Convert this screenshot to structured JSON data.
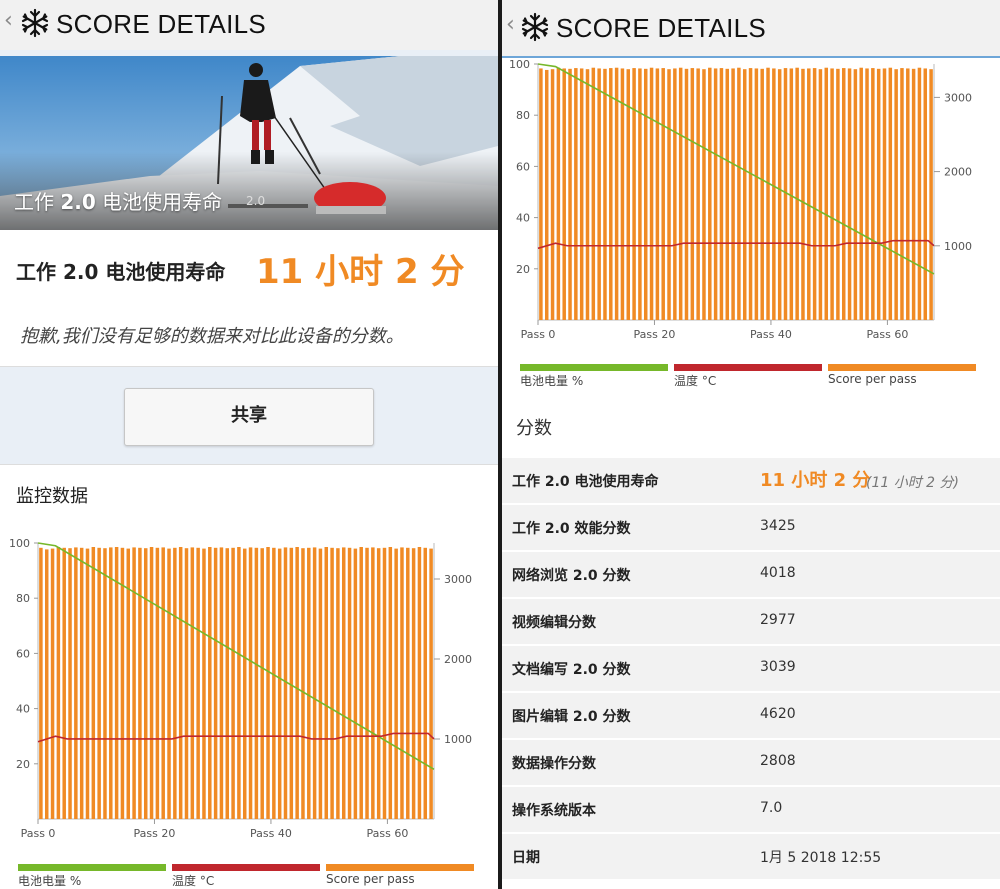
{
  "app": {
    "title": "SCORE DETAILS"
  },
  "left": {
    "hero_caption_prefix": "工作 ",
    "hero_caption_bold": "2.0",
    "hero_caption_suffix": " 电池使用寿命",
    "hero_version": "2.0",
    "result_name": "工作 2.0 电池使用寿命",
    "result_score": "11 小时 2 分",
    "sorry_text": "抱歉,我们没有足够的数据来对比此设备的分数。",
    "share_label": "共享",
    "monitor_title": "监控数据"
  },
  "legend": {
    "battery": "电池电量 %",
    "temp": "温度 °C",
    "score": "Score per pass"
  },
  "colors": {
    "battery": "#76b82a",
    "temp": "#c0272d",
    "score": "#f08a24",
    "accent": "#f08a24"
  },
  "scores": {
    "title": "分数",
    "rows": [
      {
        "label": "工作 2.0 电池使用寿命",
        "value": "11 小时 2 分",
        "sub": "(11 小时 2 分)"
      },
      {
        "label": "工作 2.0 效能分数",
        "value": "3425"
      },
      {
        "label": "网络浏览 2.0 分数",
        "value": "4018"
      },
      {
        "label": "视频编辑分数",
        "value": "2977"
      },
      {
        "label": "文档编写 2.0 分数",
        "value": "3039"
      },
      {
        "label": "图片编辑 2.0 分数",
        "value": "4620"
      },
      {
        "label": "数据操作分数",
        "value": "2808"
      },
      {
        "label": "操作系统版本",
        "value": "7.0"
      },
      {
        "label": "日期",
        "value": "1月 5 2018 12:55"
      }
    ]
  },
  "chart_data": {
    "type": "bar",
    "x_tick_labels": [
      "Pass 0",
      "Pass 20",
      "Pass 40",
      "Pass 60"
    ],
    "x_ticks": [
      0,
      20,
      40,
      60
    ],
    "x_range": [
      0,
      68
    ],
    "y_left_ticks": [
      20,
      40,
      60,
      80,
      100
    ],
    "y_left_range": [
      0,
      100
    ],
    "y_right_ticks": [
      1000,
      2000,
      3000
    ],
    "y_right_range": [
      0,
      3450
    ],
    "grid": false,
    "legend_position": "bottom",
    "series": [
      {
        "name": "Score per pass",
        "type": "bar",
        "axis": "right",
        "values": [
          3390,
          3370,
          3380,
          3400,
          3390,
          3385,
          3395,
          3390,
          3380,
          3400,
          3390,
          3385,
          3395,
          3400,
          3390,
          3380,
          3395,
          3390,
          3385,
          3400,
          3390,
          3395,
          3380,
          3390,
          3400,
          3385,
          3395,
          3390,
          3380,
          3400,
          3390,
          3395,
          3385,
          3390,
          3400,
          3380,
          3395,
          3390,
          3385,
          3400,
          3390,
          3380,
          3395,
          3390,
          3400,
          3385,
          3390,
          3395,
          3380,
          3400,
          3390,
          3385,
          3395,
          3390,
          3380,
          3400,
          3390,
          3395,
          3385,
          3390,
          3400,
          3380,
          3395,
          3390,
          3385,
          3400,
          3390,
          3380
        ]
      },
      {
        "name": "电池电量 %",
        "type": "line",
        "axis": "left",
        "x": [
          0,
          3,
          68
        ],
        "values": [
          100,
          99,
          18
        ]
      },
      {
        "name": "温度 °C",
        "type": "line",
        "axis": "left",
        "x": [
          0,
          3,
          5,
          23,
          25,
          45,
          47,
          51,
          53,
          59,
          61,
          67,
          68
        ],
        "values": [
          28,
          30,
          29,
          29,
          30,
          30,
          29,
          29,
          30,
          30,
          31,
          31,
          29
        ]
      }
    ]
  }
}
